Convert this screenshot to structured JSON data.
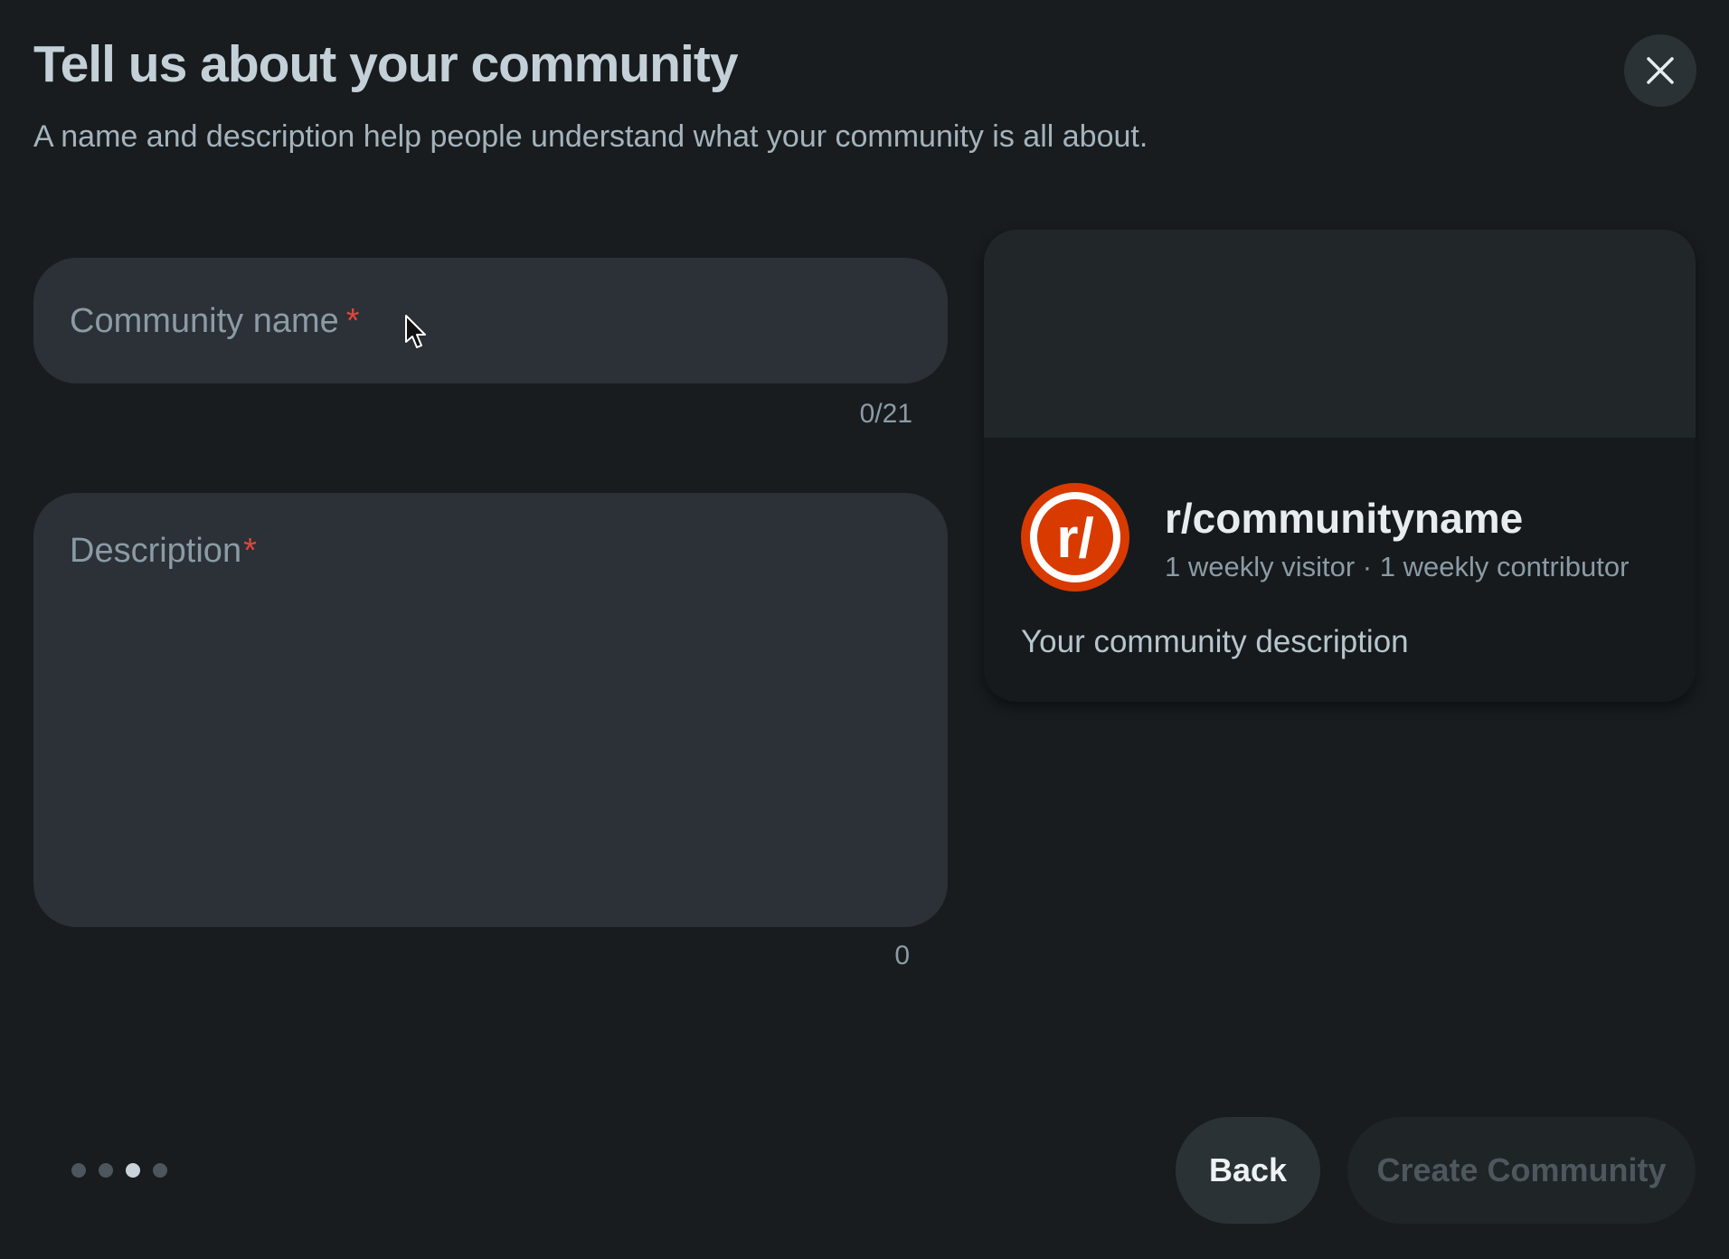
{
  "header": {
    "title": "Tell us about your community",
    "subtitle": "A name and description help people understand what your community is all about.",
    "close_icon": "close-icon"
  },
  "form": {
    "name_field": {
      "label": "Community name",
      "required_mark": "*",
      "value": "",
      "counter": "0/21"
    },
    "description_field": {
      "label": "Description",
      "required_mark": "*",
      "value": "",
      "counter": "0"
    }
  },
  "preview": {
    "avatar_icon": "reddit-r-slash-logo",
    "avatar_text": "r/",
    "name": "r/communityname",
    "stats": "1 weekly visitor · 1 weekly contributor",
    "description": "Your community description"
  },
  "progress": {
    "total_steps": 4,
    "current_step": 3
  },
  "footer": {
    "back_label": "Back",
    "create_label": "Create Community"
  },
  "colors": {
    "background": "#181c1f",
    "field_bg": "#2b3136",
    "required": "#e0463b",
    "avatar_orange": "#d93a00"
  }
}
